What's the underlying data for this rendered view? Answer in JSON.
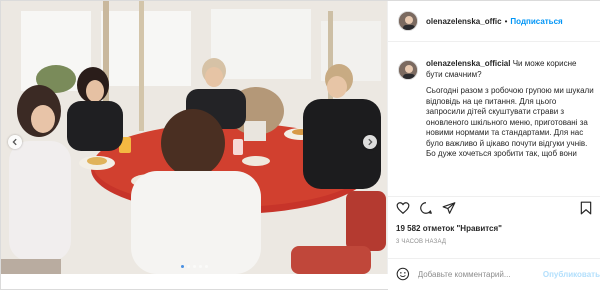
{
  "post": {
    "username": "olenazelenska_official",
    "header_username": "olenazelenska_offic",
    "separator": "•",
    "follow_label": "Подписаться"
  },
  "caption": {
    "username": "olenazelenska_official",
    "paragraph1": "Чи може корисне бути смачним?",
    "paragraph2": "Сьогодні разом з робочою групою ми шукали відповідь на це питання. Для цього запросили дітей скуштувати страви з оновленого шкільного меню, приготовані за новими нормами та стандартами. Для нас було важливо й цікаво почути відгуки учнів. Бо дуже хочеться зробити так, щоб вони"
  },
  "actions": {
    "like_icon": "heart-icon",
    "comment_icon": "comment-icon",
    "share_icon": "share-icon",
    "save_icon": "bookmark-icon"
  },
  "likes": {
    "count": "19 582",
    "label": "отметок \"Нравится\""
  },
  "timestamp": "3 ЧАСОВ НАЗАД",
  "comment": {
    "placeholder": "Добавьте комментарий...",
    "publish_label": "Опубликовать"
  },
  "carousel": {
    "total": 5,
    "active_index": 0
  },
  "colors": {
    "accent": "#0095f6",
    "publish_disabled": "#b2dffc",
    "muted": "#8e8e8e",
    "table_red": "#c7342a"
  }
}
